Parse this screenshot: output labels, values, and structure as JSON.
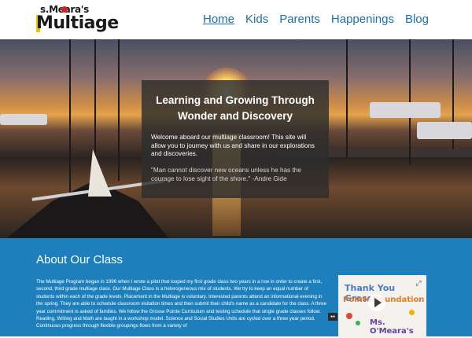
{
  "logo": {
    "top": "s.Meara's",
    "main": "Multiage"
  },
  "nav": {
    "items": [
      "Home",
      "Kids",
      "Parents",
      "Happenings",
      "Blog"
    ],
    "active": "Home"
  },
  "hero": {
    "heading": "Learning and Growing Through Wonder and Discovery",
    "welcome": "Welcome aboard our multiage classroom! This site will allow you to journey with us and share in our explorations and discoveries.",
    "quote": "\"Man cannot discover new oceans unless he has the courage to lose sight of the shore.\" -Andre Gide"
  },
  "about": {
    "title": "About Our Class",
    "body": "The Multiage Program began in 1996 when I wrote a pilot that looped my first grade class two years in a row in order to create a first, second, third grade multiage class. Our Multiage Class is a heterogeneous mix of students. We try to keep an equal number of students within each of the grade levels. Placement in the Multiage is voluntary. Interested parents attend an informational evening in the spring. They are able to schedule classroom visitation times and then submit their child's name as a candidate for the class. A three year commitment is asked of families. We follow the Grosse Pointe Curriculum and testing schedule that single grade classes follow. Reading, Writing and Math are taught in a workshop model. Science and Social Studies Units are cycled over a three year period. Continuous progress through flexible groupings flows from a variety of",
    "thumb": {
      "line1": "Thank You Grosse",
      "line2": "Pointe Foundation",
      "line3": "Ms. O'Meara's"
    }
  },
  "colors": {
    "brand_blue": "#1d80bd",
    "nav_link": "#1e6fb0",
    "logo_apple": "#d92020"
  }
}
